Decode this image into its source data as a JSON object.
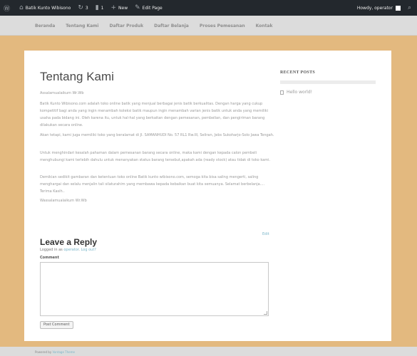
{
  "admin_bar": {
    "wp_logo_icon": "wordpress-icon",
    "site_icon": "home-icon",
    "site_name": "Batik Kunto Wibisono",
    "updates_count": "3",
    "comments_count": "1",
    "new_label": "New",
    "edit_label": "Edit Page",
    "greeting": "Howdy, operator",
    "search_icon": "search-icon"
  },
  "nav": {
    "items": [
      "Beranda",
      "Tentang Kami",
      "Daftar Produk",
      "Daftar Belanja",
      "Proses Pemesanan",
      "Kontak"
    ]
  },
  "page": {
    "title": "Tentang Kami",
    "paragraphs": [
      "Assalamualaikum Wr.Wb",
      "Batik Kunto Wibisono.com adalah toko online batik yang menjual berbagai jenis batik berkualitas. Dengan harga yang cukup kompetitif bagi anda yang ingin menambah koleksi batik maupun ingin menambah varian jenis batik untuk anda yang memiliki usaha pada bidang ini. Oleh karena itu, untuk hal-hal yang berkaitan dengan pemesanan, pembelian, dan pengiriman barang dilakukan secara online.",
      "Akan tetapi, kami juga memiliki toko yang beralamat di Jl. SAMANHUDI No. 57 RL1 Rw.III, Seliran, Jebs Sukoharjo-Solo Jawa Tengah.",
      "Untuk menghindari kesalah pahaman dalam pemesanan barang secara online, maka kami dengan kepada calon pembeli menghubungi kami terlebih dahulu untuk menanyakan status barang tersebut,apakah ada (ready stock) atau tidak di toko kami.",
      "Demikian sedikit gambaran dan ketentuan toko online Batik kunto wibisono.com, semoga kita bisa saling mengerti, saling menghargai dan selalu menjalin tali silaturahim yang membawa kepada kebaikan buat kita semuanya. Selamat berbelanja.... Terima Kasih..",
      "Wassalamualaikum Wr.Wb"
    ],
    "edit_link": "Edit"
  },
  "comments": {
    "title": "Leave a Reply",
    "logged_in_prefix": "Logged in as",
    "user_link": "operator",
    "logout_link": "Log out?",
    "comment_label": "Comment",
    "comment_value": "",
    "submit_label": "Post Comment"
  },
  "sidebar": {
    "widget_title": "RECENT POSTS",
    "posts": [
      "Hello world!"
    ]
  },
  "footer": {
    "powered_prefix": "Powered by",
    "powered_link": "Vantage Theme"
  },
  "colors": {
    "page_background": "#e3b97f",
    "admin_bar": "#23282d",
    "link": "#7ab6c9"
  }
}
